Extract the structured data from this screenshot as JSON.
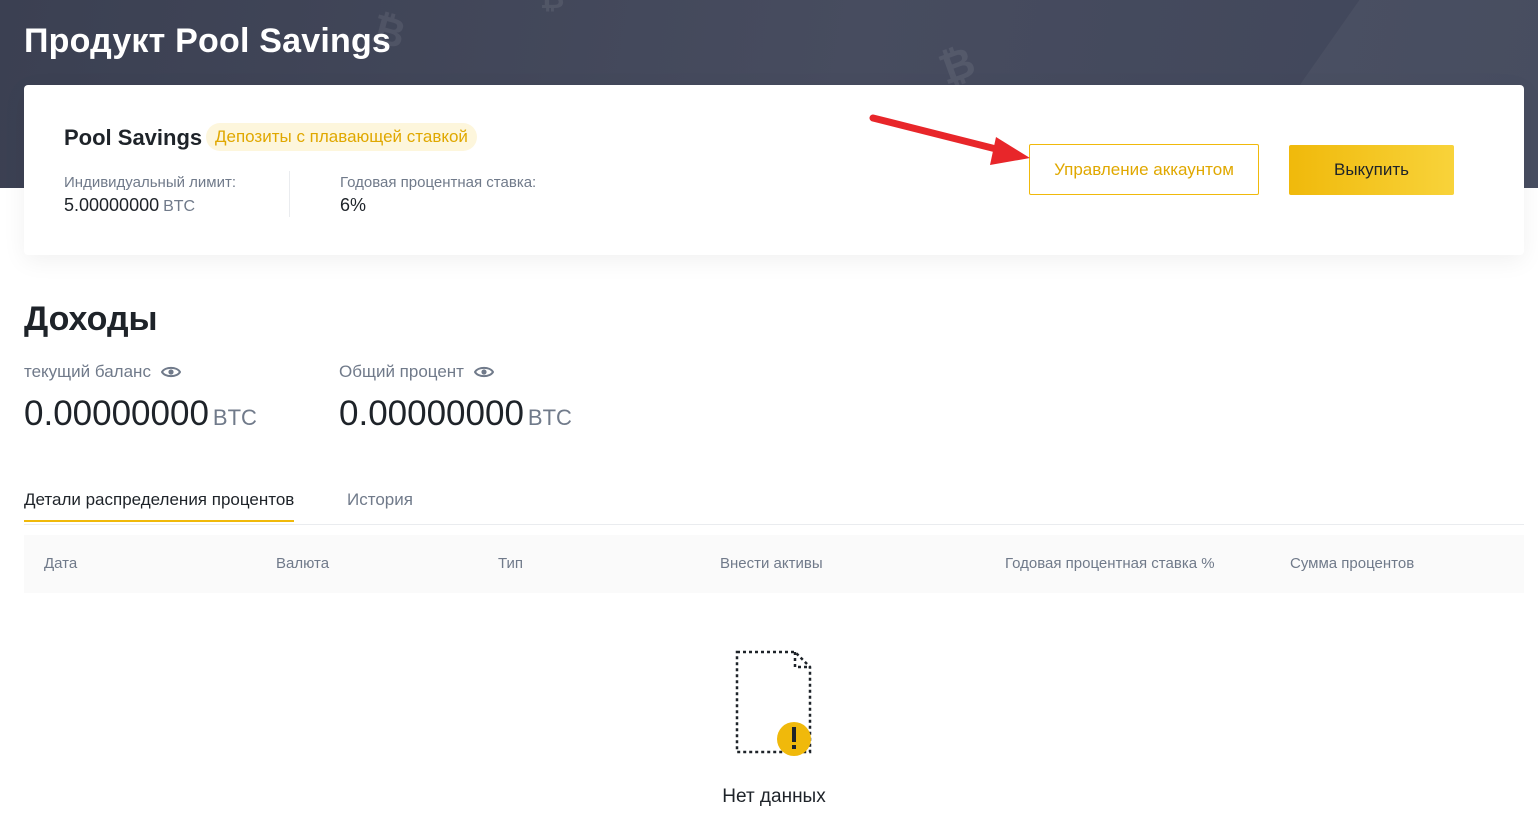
{
  "page": {
    "title": "Продукт Pool Savings"
  },
  "product": {
    "name": "Pool Savings",
    "tag": "Депозиты с плавающей ставкой",
    "limit_label": "Индивидуальный лимит:",
    "limit_value": "5.00000000",
    "limit_unit": "BTC",
    "apy_label": "Годовая процентная ставка:",
    "apy_value": "6%",
    "manage_label": "Управление аккаунтом",
    "redeem_label": "Выкупить"
  },
  "earnings": {
    "title": "Доходы",
    "current_label": "текущий баланс",
    "current_value": "0.00000000",
    "current_unit": "BTC",
    "total_label": "Общий процент",
    "total_value": "0.00000000",
    "total_unit": "BTC"
  },
  "tabs": [
    {
      "label": "Детали распределения процентов",
      "active": true
    },
    {
      "label": "История",
      "active": false
    }
  ],
  "table": {
    "columns": [
      "Дата",
      "Валюта",
      "Тип",
      "Внести активы",
      "Годовая процентная ставка %",
      "Сумма процентов"
    ],
    "rows": [],
    "empty_text": "Нет данных"
  },
  "colors": {
    "accent": "#f0b90b",
    "accent_text": "#e0a800",
    "hero_bg": "#40465a",
    "annotation_arrow": "#e8262a"
  },
  "icons": {
    "visibility": "eye-icon",
    "empty": "empty-document-warning-icon",
    "background": "bitcoin-logo-icon"
  }
}
